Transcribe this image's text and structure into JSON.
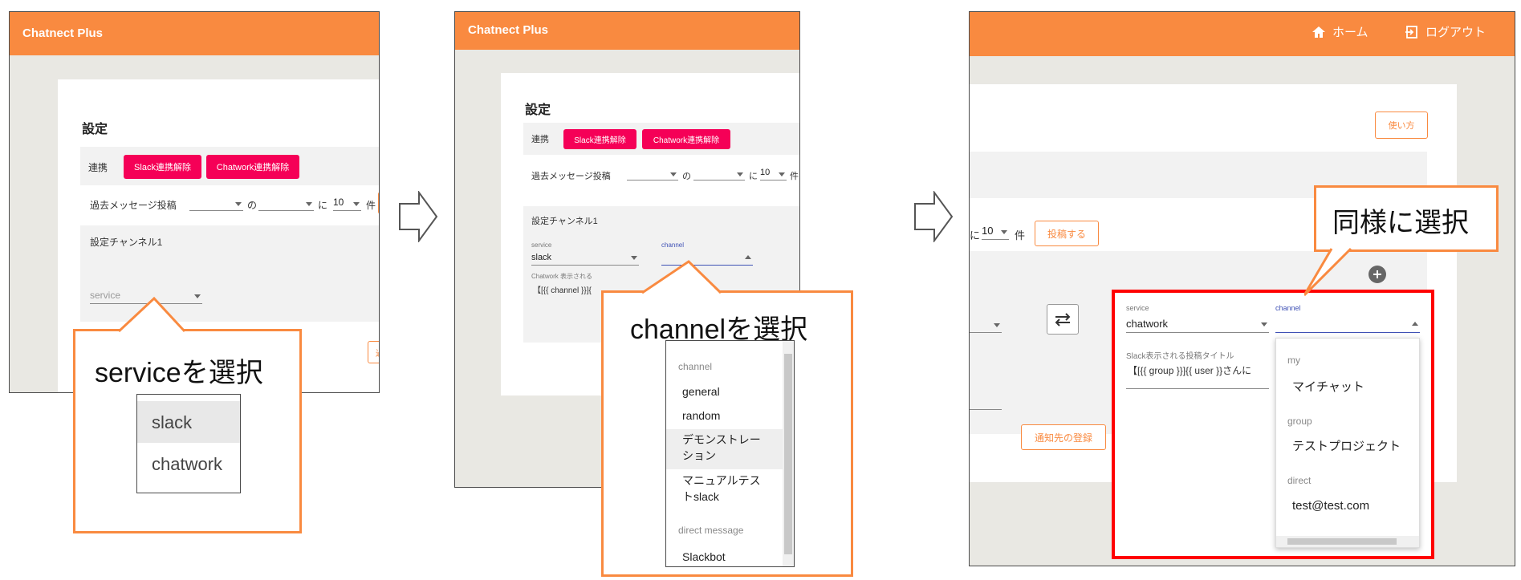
{
  "app": {
    "title": "Chatnect Plus"
  },
  "settings": {
    "heading": "設定",
    "link_label": "連携",
    "slack_unlink_button": "Slack連携解除",
    "chatwork_unlink_button": "Chatwork連携解除",
    "past_posts_label": "過去メッセージ投稿",
    "of_label": "の",
    "ni_label": "に",
    "count_value": "10",
    "count_unit": "件",
    "channel_section_title": "設定チャンネル1",
    "service_label": "service",
    "channel_label": "channel",
    "service_placeholder": "service",
    "service_value_slack": "slack",
    "service_value_chatwork": "chatwork",
    "chatwork_title_label": "Chatwork 表示される",
    "chatwork_title_value": "【[{{ channel }}]{",
    "slack_title_label": "Slack表示される投稿タイトル",
    "slack_title_value": "【[{{ group }}]{{ user }}さんに",
    "post_button": "投稿する",
    "notify_button": "通知先の登録",
    "usage_button": "使い方",
    "truncated_button": "過"
  },
  "nav": {
    "home": "ホーム",
    "logout": "ログアウト"
  },
  "callouts": {
    "step1": "serviceを選択",
    "step2": "channelを選択",
    "step3": "同様に選択"
  },
  "service_options": [
    "slack",
    "chatwork"
  ],
  "slack_channel_list": {
    "group1": "channel",
    "items1": [
      "general",
      "random",
      "デモンストレー\nション",
      "マニュアルテス\nトslack"
    ],
    "group2": "direct message",
    "items2": [
      "Slackbot"
    ]
  },
  "chatwork_channel_list": {
    "group1": "my",
    "item1": "マイチャット",
    "group2": "group",
    "item2": "テストプロジェクト",
    "group3": "direct",
    "item3": "test@test.com"
  },
  "colors": {
    "header": "#f98a40",
    "pink": "#f50057",
    "highlight_red": "#ff0000",
    "channel_blue": "#3f51b5"
  }
}
